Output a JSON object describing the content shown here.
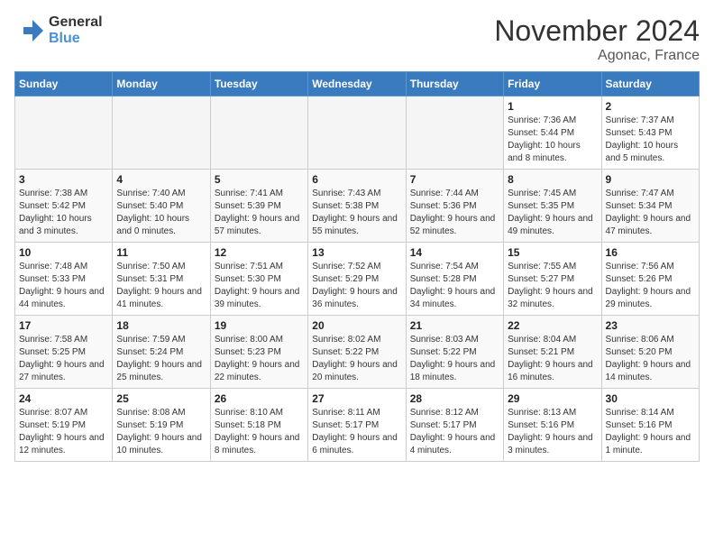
{
  "logo": {
    "line1": "General",
    "line2": "Blue"
  },
  "title": "November 2024",
  "subtitle": "Agonac, France",
  "weekdays": [
    "Sunday",
    "Monday",
    "Tuesday",
    "Wednesday",
    "Thursday",
    "Friday",
    "Saturday"
  ],
  "weeks": [
    [
      {
        "day": "",
        "info": ""
      },
      {
        "day": "",
        "info": ""
      },
      {
        "day": "",
        "info": ""
      },
      {
        "day": "",
        "info": ""
      },
      {
        "day": "",
        "info": ""
      },
      {
        "day": "1",
        "info": "Sunrise: 7:36 AM\nSunset: 5:44 PM\nDaylight: 10 hours and 8 minutes."
      },
      {
        "day": "2",
        "info": "Sunrise: 7:37 AM\nSunset: 5:43 PM\nDaylight: 10 hours and 5 minutes."
      }
    ],
    [
      {
        "day": "3",
        "info": "Sunrise: 7:38 AM\nSunset: 5:42 PM\nDaylight: 10 hours and 3 minutes."
      },
      {
        "day": "4",
        "info": "Sunrise: 7:40 AM\nSunset: 5:40 PM\nDaylight: 10 hours and 0 minutes."
      },
      {
        "day": "5",
        "info": "Sunrise: 7:41 AM\nSunset: 5:39 PM\nDaylight: 9 hours and 57 minutes."
      },
      {
        "day": "6",
        "info": "Sunrise: 7:43 AM\nSunset: 5:38 PM\nDaylight: 9 hours and 55 minutes."
      },
      {
        "day": "7",
        "info": "Sunrise: 7:44 AM\nSunset: 5:36 PM\nDaylight: 9 hours and 52 minutes."
      },
      {
        "day": "8",
        "info": "Sunrise: 7:45 AM\nSunset: 5:35 PM\nDaylight: 9 hours and 49 minutes."
      },
      {
        "day": "9",
        "info": "Sunrise: 7:47 AM\nSunset: 5:34 PM\nDaylight: 9 hours and 47 minutes."
      }
    ],
    [
      {
        "day": "10",
        "info": "Sunrise: 7:48 AM\nSunset: 5:33 PM\nDaylight: 9 hours and 44 minutes."
      },
      {
        "day": "11",
        "info": "Sunrise: 7:50 AM\nSunset: 5:31 PM\nDaylight: 9 hours and 41 minutes."
      },
      {
        "day": "12",
        "info": "Sunrise: 7:51 AM\nSunset: 5:30 PM\nDaylight: 9 hours and 39 minutes."
      },
      {
        "day": "13",
        "info": "Sunrise: 7:52 AM\nSunset: 5:29 PM\nDaylight: 9 hours and 36 minutes."
      },
      {
        "day": "14",
        "info": "Sunrise: 7:54 AM\nSunset: 5:28 PM\nDaylight: 9 hours and 34 minutes."
      },
      {
        "day": "15",
        "info": "Sunrise: 7:55 AM\nSunset: 5:27 PM\nDaylight: 9 hours and 32 minutes."
      },
      {
        "day": "16",
        "info": "Sunrise: 7:56 AM\nSunset: 5:26 PM\nDaylight: 9 hours and 29 minutes."
      }
    ],
    [
      {
        "day": "17",
        "info": "Sunrise: 7:58 AM\nSunset: 5:25 PM\nDaylight: 9 hours and 27 minutes."
      },
      {
        "day": "18",
        "info": "Sunrise: 7:59 AM\nSunset: 5:24 PM\nDaylight: 9 hours and 25 minutes."
      },
      {
        "day": "19",
        "info": "Sunrise: 8:00 AM\nSunset: 5:23 PM\nDaylight: 9 hours and 22 minutes."
      },
      {
        "day": "20",
        "info": "Sunrise: 8:02 AM\nSunset: 5:22 PM\nDaylight: 9 hours and 20 minutes."
      },
      {
        "day": "21",
        "info": "Sunrise: 8:03 AM\nSunset: 5:22 PM\nDaylight: 9 hours and 18 minutes."
      },
      {
        "day": "22",
        "info": "Sunrise: 8:04 AM\nSunset: 5:21 PM\nDaylight: 9 hours and 16 minutes."
      },
      {
        "day": "23",
        "info": "Sunrise: 8:06 AM\nSunset: 5:20 PM\nDaylight: 9 hours and 14 minutes."
      }
    ],
    [
      {
        "day": "24",
        "info": "Sunrise: 8:07 AM\nSunset: 5:19 PM\nDaylight: 9 hours and 12 minutes."
      },
      {
        "day": "25",
        "info": "Sunrise: 8:08 AM\nSunset: 5:19 PM\nDaylight: 9 hours and 10 minutes."
      },
      {
        "day": "26",
        "info": "Sunrise: 8:10 AM\nSunset: 5:18 PM\nDaylight: 9 hours and 8 minutes."
      },
      {
        "day": "27",
        "info": "Sunrise: 8:11 AM\nSunset: 5:17 PM\nDaylight: 9 hours and 6 minutes."
      },
      {
        "day": "28",
        "info": "Sunrise: 8:12 AM\nSunset: 5:17 PM\nDaylight: 9 hours and 4 minutes."
      },
      {
        "day": "29",
        "info": "Sunrise: 8:13 AM\nSunset: 5:16 PM\nDaylight: 9 hours and 3 minutes."
      },
      {
        "day": "30",
        "info": "Sunrise: 8:14 AM\nSunset: 5:16 PM\nDaylight: 9 hours and 1 minute."
      }
    ]
  ]
}
